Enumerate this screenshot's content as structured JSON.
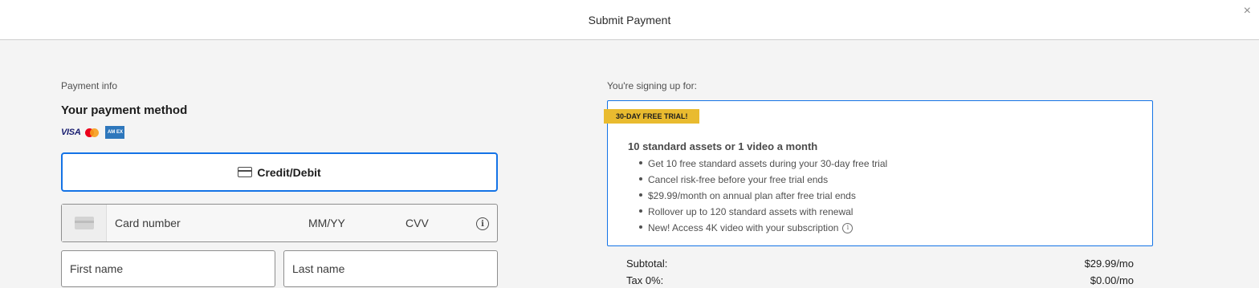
{
  "header": {
    "title": "Submit Payment",
    "close": "×"
  },
  "payment": {
    "section_label": "Payment info",
    "method_title": "Your payment method",
    "cards": {
      "visa": "VISA",
      "amex": "AM EX"
    },
    "credit_button": "Credit/Debit",
    "card_number": "Card number",
    "expiry": "MM/YY",
    "cvv": "CVV",
    "info_glyph": "i",
    "first_name_placeholder": "First name",
    "last_name_placeholder": "Last name"
  },
  "plan": {
    "section_label": "You're signing up for:",
    "badge": "30-DAY FREE TRIAL!",
    "heading": "10 standard assets or 1 video a month",
    "bullets": [
      "Get 10 free standard assets during your 30-day free trial",
      "Cancel risk-free before your free trial ends",
      "$29.99/month on annual plan after free trial ends",
      "Rollover up to 120 standard assets with renewal",
      "New! Access 4K video with your subscription"
    ],
    "info_glyph": "i"
  },
  "summary": {
    "subtotal_label": "Subtotal:",
    "subtotal_value": "$29.99/mo",
    "tax_label": "Tax 0%:",
    "tax_value": "$0.00/mo"
  },
  "colors": {
    "accent": "#1473e6",
    "badge": "#e9bb2f",
    "background": "#f4f4f4"
  }
}
